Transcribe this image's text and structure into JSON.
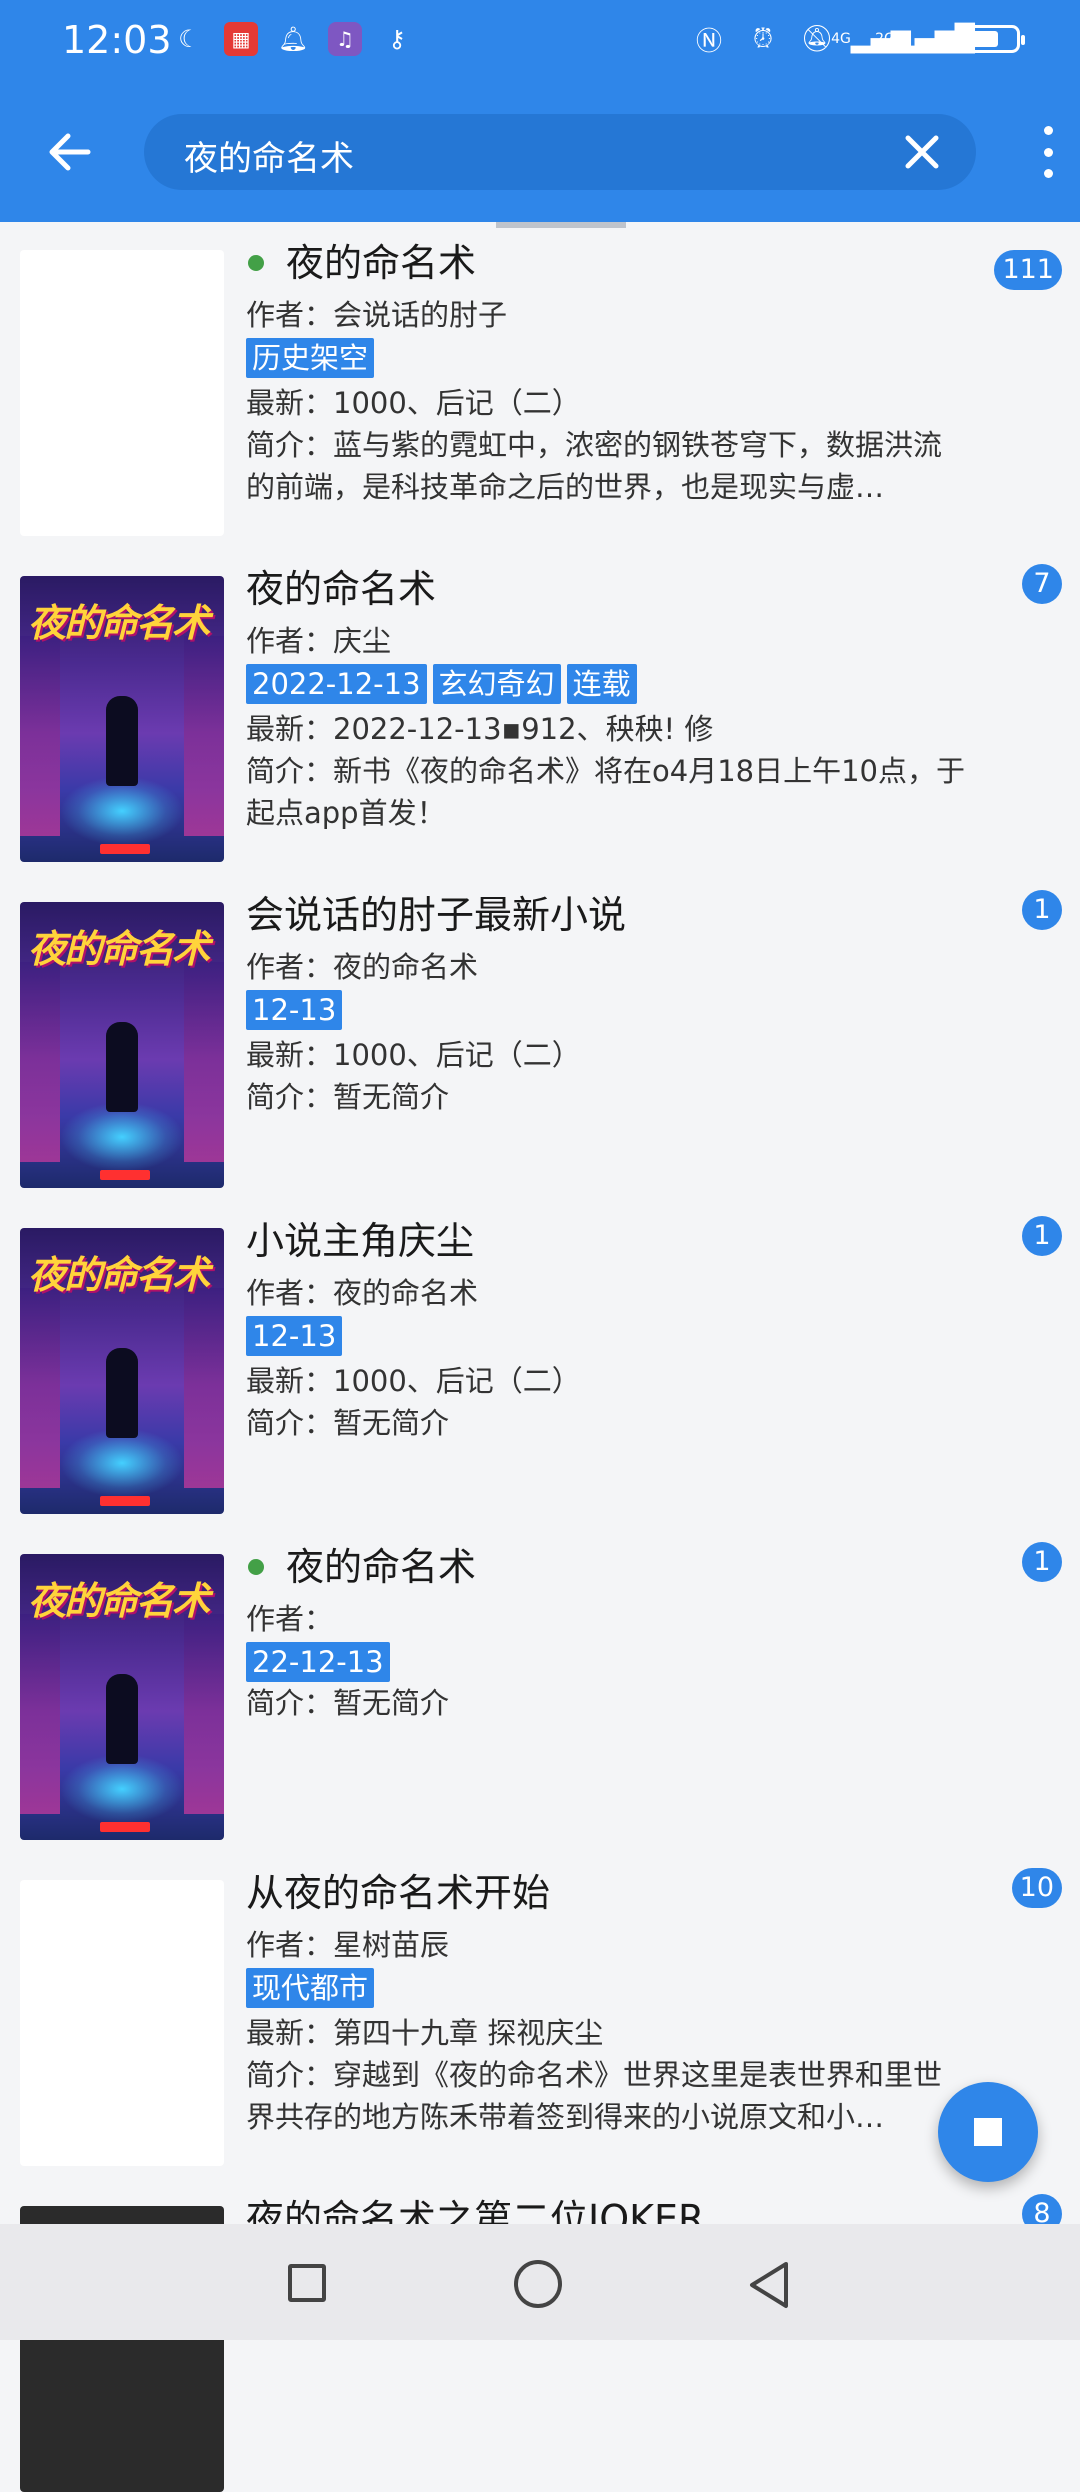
{
  "status_bar": {
    "time": "12:03",
    "left_icons": [
      "moon-icon",
      "app-red-icon",
      "notification-bell-icon",
      "music-app-icon",
      "key-icon"
    ],
    "right_icons": [
      "nfc-icon",
      "alarm-icon",
      "mute-bell-icon",
      "signal-4g-icon",
      "signal-2g-icon"
    ],
    "network_1": "4G",
    "network_2": "2G",
    "battery_level": 0.65
  },
  "header": {
    "search_value": "夜的命名术",
    "back_icon": "back-arrow-icon",
    "clear_icon": "close-icon",
    "more_icon": "more-vert-icon"
  },
  "results": [
    {
      "title": "夜的命名术",
      "has_dot": true,
      "cover": "blank",
      "author": "作者：会说话的肘子",
      "tags": [
        "历史架空"
      ],
      "latest": "最新：1000、后记（二）",
      "intro": "简介：蓝与紫的霓虹中，浓密的钢铁苍穹下，数据洪流的前端，是科技革命之后的世界，也是现实与虚…",
      "count": "111"
    },
    {
      "title": "夜的命名术",
      "has_dot": false,
      "cover": "art",
      "cover_title": "夜的命名术",
      "author": "作者：庆尘",
      "tags": [
        "2022-12-13",
        "玄幻奇幻",
        "连载"
      ],
      "latest": "最新：2022-12-13▪912、秧秧! 修",
      "intro": "简介：新书《夜的命名术》将在o4月18日上午10点，于起点app首发！",
      "count": "7"
    },
    {
      "title": "会说话的肘子最新小说",
      "has_dot": false,
      "cover": "art",
      "cover_title": "夜的命名术",
      "author": "作者：夜的命名术",
      "tags": [
        "12-13"
      ],
      "latest": "最新：1000、后记（二）",
      "intro": "简介：暂无简介",
      "count": "1"
    },
    {
      "title": "小说主角庆尘",
      "has_dot": false,
      "cover": "art",
      "cover_title": "夜的命名术",
      "author": "作者：夜的命名术",
      "tags": [
        "12-13"
      ],
      "latest": "最新：1000、后记（二）",
      "intro": "简介：暂无简介",
      "count": "1"
    },
    {
      "title": "夜的命名术",
      "has_dot": true,
      "cover": "art",
      "cover_title": "夜的命名术",
      "author": "作者：",
      "tags": [
        "22-12-13"
      ],
      "latest": "",
      "intro": "简介：暂无简介",
      "count": "1"
    },
    {
      "title": "从夜的命名术开始",
      "has_dot": false,
      "cover": "blank",
      "author": "作者：星树苗辰",
      "tags": [
        "现代都市"
      ],
      "latest": "最新：第四十九章 探视庆尘",
      "intro": "简介：穿越到《夜的命名术》世界这里是表世界和里世界共存的地方陈禾带着签到得来的小说原文和小…",
      "count": "10"
    },
    {
      "title": "夜的命名术之第二位JOKER",
      "has_dot": false,
      "cover": "dark",
      "author": "",
      "tags": [],
      "latest": "",
      "intro": "",
      "count": "8"
    }
  ],
  "colors": {
    "primary": "#2f86e9",
    "dot": "#43a047",
    "background": "#f4f5f7"
  }
}
